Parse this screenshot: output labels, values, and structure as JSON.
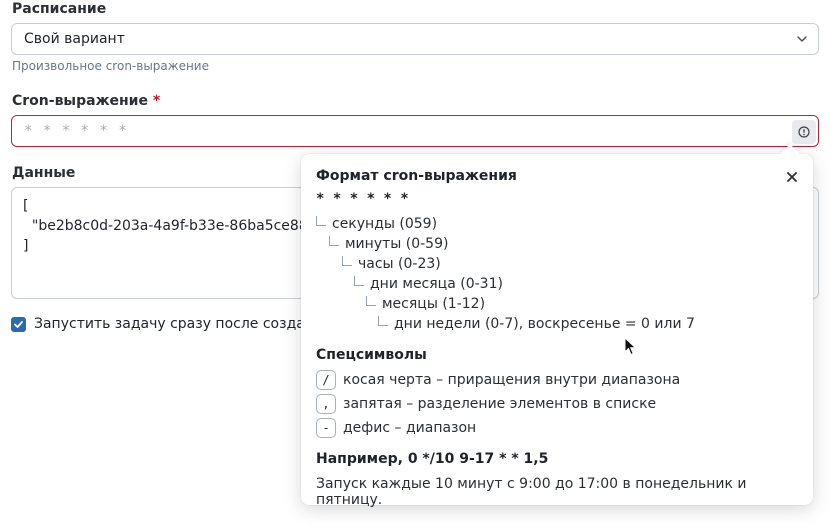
{
  "schedule": {
    "label": "Расписание",
    "selected": "Свой вариант",
    "hint": "Произвольное cron-выражение"
  },
  "cron": {
    "label": "Cron-выражение",
    "required_mark": "*",
    "placeholder": "* * * * * *",
    "value": ""
  },
  "data_field": {
    "label": "Данные",
    "value": "[\n  \"be2b8c0d-203a-4a9f-b33e-86ba5ce88786\n]"
  },
  "run_now": {
    "label": "Запустить задачу сразу после создания",
    "checked": true
  },
  "popover": {
    "title": "Формат cron-выражения",
    "pattern": "* * * * * *",
    "tree": [
      "секунды (059)",
      "минуты (0-59)",
      "часы (0-23)",
      "дни месяца (0-31)",
      "месяцы (1-12)",
      "дни недели (0-7), воскресенье = 0 или 7"
    ],
    "special_title": "Спецсимволы",
    "specials": [
      {
        "symbol": "/",
        "text": "косая черта – приращения внутри диапазона"
      },
      {
        "symbol": ",",
        "text": "запятая – разделение элементов в списке"
      },
      {
        "symbol": "-",
        "text": "дефис – диапазон"
      }
    ],
    "example_title": "Например, 0 */10 9-17 * * 1,5",
    "example_desc": "Запуск каждые 10 минут с 9:00 до 17:00 в понедельник и пятницу."
  },
  "colors": {
    "accent": "#2b6cb0",
    "error_border": "#b3263c",
    "required": "#c8102e"
  }
}
